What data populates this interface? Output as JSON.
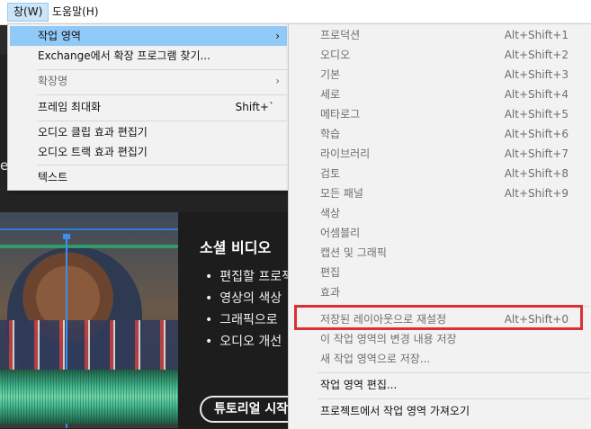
{
  "menubar": {
    "items": [
      "창(W)",
      "도움말(H)"
    ]
  },
  "background": {
    "stray_letter": "e",
    "hero_title": "소셜 비디오",
    "bullets": [
      "편집할 프로젝",
      "영상의 색상",
      "그래픽으로",
      "오디오 개선"
    ],
    "button_label": "튜토리얼 시작"
  },
  "window_menu": {
    "items": [
      {
        "label": "작업 영역",
        "shortcut": "",
        "submenu": true,
        "enabled": true,
        "highlighted": true
      },
      {
        "label": "Exchange에서 확장 프로그램 찾기...",
        "shortcut": "",
        "submenu": false,
        "enabled": true
      },
      {
        "label": "확장명",
        "shortcut": "",
        "submenu": true,
        "enabled": false
      },
      {
        "label": "프레임 최대화",
        "shortcut": "Shift+`",
        "submenu": false,
        "enabled": true
      },
      {
        "label": "오디오 클립 효과 편집기",
        "shortcut": "",
        "submenu": false,
        "enabled": true
      },
      {
        "label": "오디오 트랙 효과 편집기",
        "shortcut": "",
        "submenu": false,
        "enabled": true
      },
      {
        "label": "텍스트",
        "shortcut": "",
        "submenu": false,
        "enabled": true
      }
    ]
  },
  "workspace_menu": {
    "items": [
      {
        "label": "프로덕션",
        "shortcut": "Alt+Shift+1",
        "enabled": false
      },
      {
        "label": "오디오",
        "shortcut": "Alt+Shift+2",
        "enabled": false
      },
      {
        "label": "기본",
        "shortcut": "Alt+Shift+3",
        "enabled": false
      },
      {
        "label": "세로",
        "shortcut": "Alt+Shift+4",
        "enabled": false
      },
      {
        "label": "메타로그",
        "shortcut": "Alt+Shift+5",
        "enabled": false
      },
      {
        "label": "학습",
        "shortcut": "Alt+Shift+6",
        "enabled": false
      },
      {
        "label": "라이브러리",
        "shortcut": "Alt+Shift+7",
        "enabled": false
      },
      {
        "label": "검토",
        "shortcut": "Alt+Shift+8",
        "enabled": false
      },
      {
        "label": "모든 패널",
        "shortcut": "Alt+Shift+9",
        "enabled": false
      },
      {
        "label": "색상",
        "shortcut": "",
        "enabled": false
      },
      {
        "label": "어셈블리",
        "shortcut": "",
        "enabled": false
      },
      {
        "label": "캡션 및 그래픽",
        "shortcut": "",
        "enabled": false
      },
      {
        "label": "편집",
        "shortcut": "",
        "enabled": false
      },
      {
        "label": "효과",
        "shortcut": "",
        "enabled": false
      },
      {
        "label": "저장된 레이아웃으로 재설정",
        "shortcut": "Alt+Shift+0",
        "enabled": false
      },
      {
        "label": "이 작업 영역의 변경 내용 저장",
        "shortcut": "",
        "enabled": false
      },
      {
        "label": "새 작업 영역으로 저장...",
        "shortcut": "",
        "enabled": false
      },
      {
        "label": "작업 영역 편집...",
        "shortcut": "",
        "enabled": true
      },
      {
        "label": "프로젝트에서 작업 영역 가져오기",
        "shortcut": "",
        "enabled": true
      }
    ]
  },
  "colors": {
    "highlight": "#91c9f7",
    "annotation": "#dc2f33",
    "menu_bg": "#f2f2f2"
  }
}
